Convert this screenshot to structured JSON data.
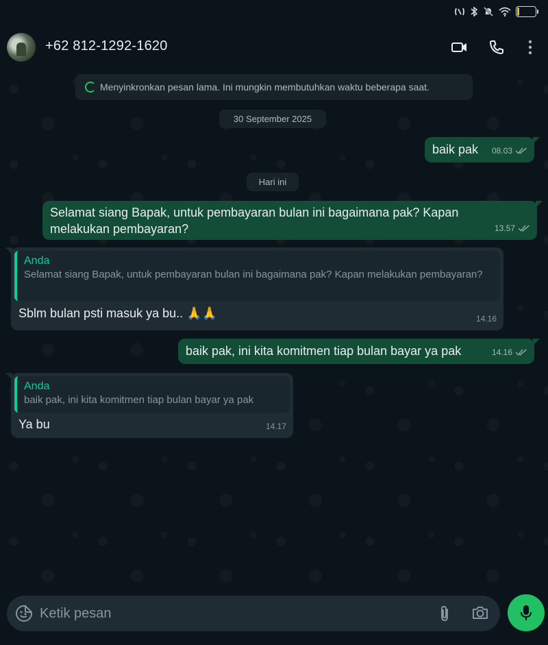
{
  "status_bar": {
    "battery_level": "11"
  },
  "header": {
    "contact_name": "+62 812-1292-1620"
  },
  "system_notice": "Menyinkronkan pesan lama. Ini mungkin membutuhkan waktu beberapa saat.",
  "date_separators": [
    "30 September 2025",
    "Hari ini"
  ],
  "messages": [
    {
      "direction": "outgoing",
      "text": "baik pak",
      "time": "08.03"
    },
    {
      "direction": "outgoing",
      "text": "Selamat siang Bapak, untuk pembayaran bulan ini bagaimana pak? Kapan melakukan pembayaran?",
      "time": "13.57"
    },
    {
      "direction": "incoming",
      "quote_author": "Anda",
      "quote_text": "Selamat siang Bapak, untuk pembayaran bulan ini bagaimana pak? Kapan melakukan pembayaran?",
      "text": "Sblm bulan psti masuk ya bu.. 🙏🙏",
      "time": "14.16"
    },
    {
      "direction": "outgoing",
      "text": "baik pak, ini kita komitmen tiap bulan bayar ya pak",
      "time": "14.16"
    },
    {
      "direction": "incoming",
      "quote_author": "Anda",
      "quote_text": "baik pak, ini kita komitmen tiap bulan bayar ya pak",
      "text": "Ya bu",
      "time": "14.17"
    }
  ],
  "composer": {
    "placeholder": "Ketik pesan"
  },
  "colors": {
    "accent": "#21c063",
    "outgoing_bubble": "#144d37",
    "incoming_bubble": "#202c33",
    "background": "#0b141a",
    "quote_accent": "#06cf9c"
  },
  "icons": [
    "video-call-icon",
    "voice-call-icon",
    "more-options-icon",
    "sticker-icon",
    "attach-icon",
    "camera-icon",
    "mic-icon"
  ]
}
